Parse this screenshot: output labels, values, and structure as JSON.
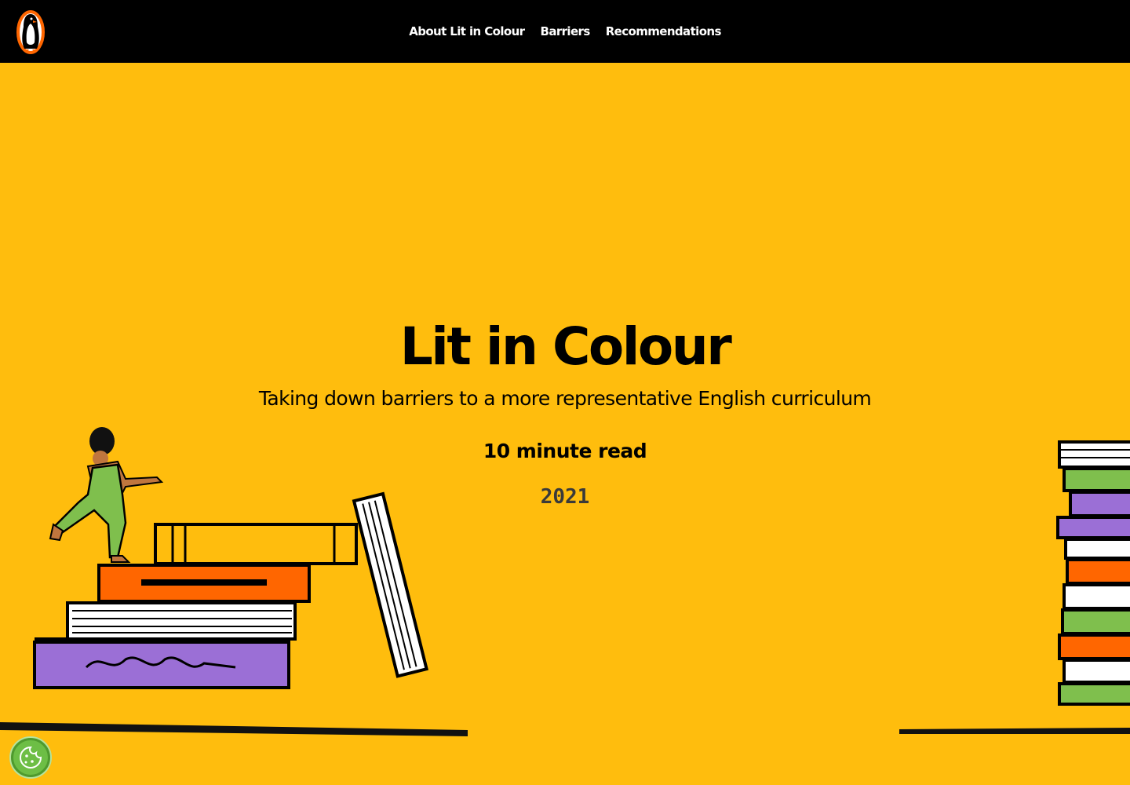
{
  "brand": {
    "logo": "penguin-logo",
    "accent": "#FFBD0D",
    "header_bg": "#000000"
  },
  "nav": {
    "items": [
      {
        "label": "About Lit in Colour"
      },
      {
        "label": "Barriers"
      },
      {
        "label": "Recommendations"
      }
    ]
  },
  "hero": {
    "title": "Lit in Colour",
    "subtitle": "Taking down barriers to a more representative English curriculum",
    "read_time": "10 minute read",
    "year": "2021"
  },
  "illustrations": {
    "left": "girl-climbing-book-stack",
    "right": "book-stack"
  },
  "cookie_button": {
    "icon": "cookie-icon",
    "color": "#6DBE45"
  }
}
